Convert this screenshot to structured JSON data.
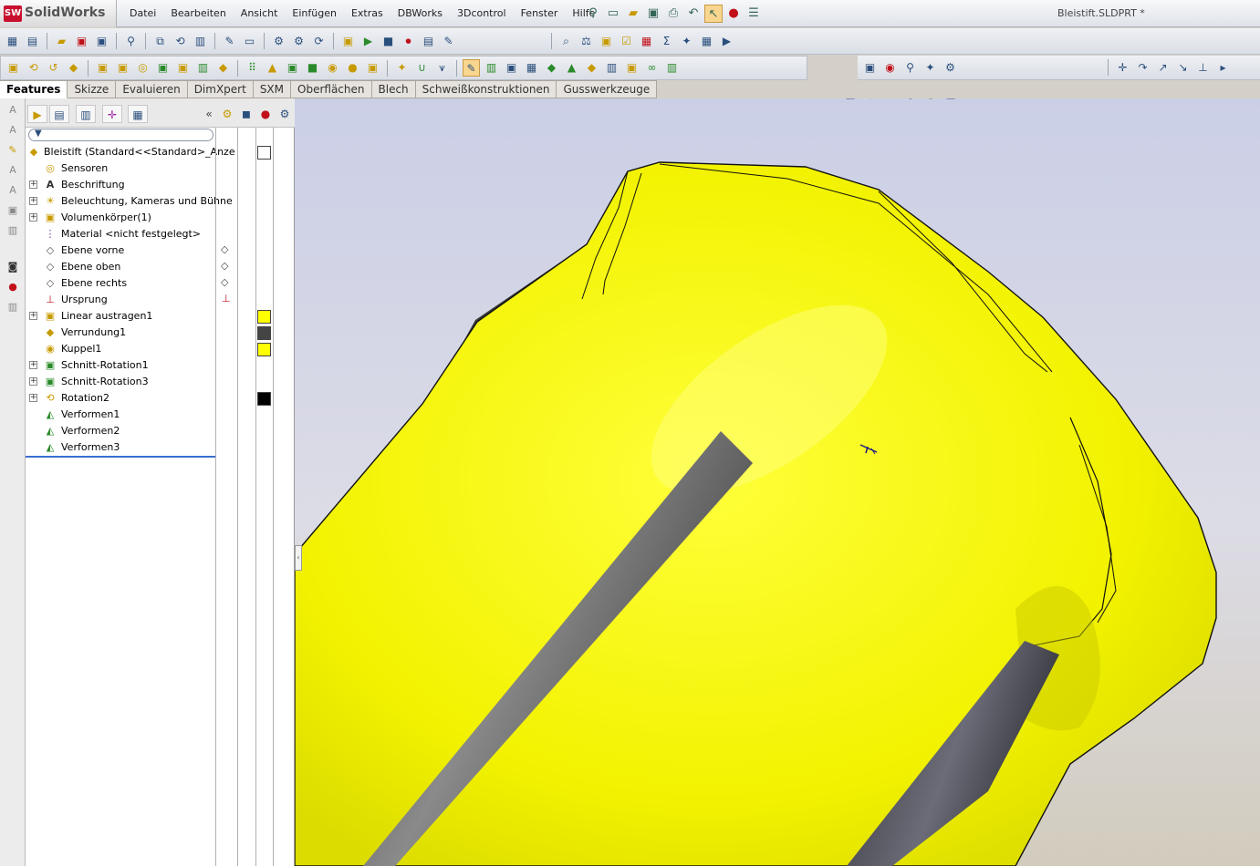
{
  "app": {
    "brand_badge": "SW",
    "brand_name": "SolidWorks",
    "document_title": "Bleistift.SLDPRT *"
  },
  "menu": [
    "Datei",
    "Bearbeiten",
    "Ansicht",
    "Einfügen",
    "Extras",
    "DBWorks",
    "3Dcontrol",
    "Fenster",
    "Hilfe"
  ],
  "command_tabs": [
    {
      "label": "Features",
      "active": true
    },
    {
      "label": "Skizze",
      "active": false
    },
    {
      "label": "Evaluieren",
      "active": false
    },
    {
      "label": "DimXpert",
      "active": false
    },
    {
      "label": "SXM",
      "active": false
    },
    {
      "label": "Oberflächen",
      "active": false
    },
    {
      "label": "Blech",
      "active": false
    },
    {
      "label": "Schweißkonstruktionen",
      "active": false
    },
    {
      "label": "Gusswerkzeuge",
      "active": false
    }
  ],
  "feature_tree": [
    {
      "label": "Bleistift  (Standard<<Standard>_Anze",
      "icon": "part-icon",
      "expandable": false,
      "root": true
    },
    {
      "label": "Sensoren",
      "icon": "sensor-icon",
      "expandable": false
    },
    {
      "label": "Beschriftung",
      "icon": "annotation-icon",
      "expandable": true
    },
    {
      "label": "Beleuchtung, Kameras und Bühne",
      "icon": "lights-icon",
      "expandable": true
    },
    {
      "label": "Volumenkörper(1)",
      "icon": "solid-bodies-icon",
      "expandable": true
    },
    {
      "label": "Material <nicht festgelegt>",
      "icon": "material-icon",
      "expandable": false
    },
    {
      "label": "Ebene vorne",
      "icon": "plane-icon",
      "expandable": false
    },
    {
      "label": "Ebene oben",
      "icon": "plane-icon",
      "expandable": false
    },
    {
      "label": "Ebene rechts",
      "icon": "plane-icon",
      "expandable": false
    },
    {
      "label": "Ursprung",
      "icon": "origin-icon",
      "expandable": false
    },
    {
      "label": "Linear austragen1",
      "icon": "extrude-icon",
      "expandable": true
    },
    {
      "label": "Verrundung1",
      "icon": "fillet-icon",
      "expandable": false
    },
    {
      "label": "Kuppel1",
      "icon": "dome-icon",
      "expandable": false
    },
    {
      "label": "Schnitt-Rotation1",
      "icon": "revolve-cut-icon",
      "expandable": true
    },
    {
      "label": "Schnitt-Rotation3",
      "icon": "revolve-cut-icon",
      "expandable": true
    },
    {
      "label": "Rotation2",
      "icon": "revolve-icon",
      "expandable": true
    },
    {
      "label": "Verformen1",
      "icon": "deform-icon",
      "expandable": false
    },
    {
      "label": "Verformen2",
      "icon": "deform-icon",
      "expandable": false
    },
    {
      "label": "Verformen3",
      "icon": "deform-icon",
      "expandable": false
    }
  ],
  "appearance_colors": {
    "part": "#ffffff",
    "extrude": "#ffff00",
    "fillet": "#444444",
    "dome": "#ffff00",
    "revolve": "#000000"
  },
  "model_colors": {
    "body": "#ffff00",
    "lead": "#555555"
  }
}
